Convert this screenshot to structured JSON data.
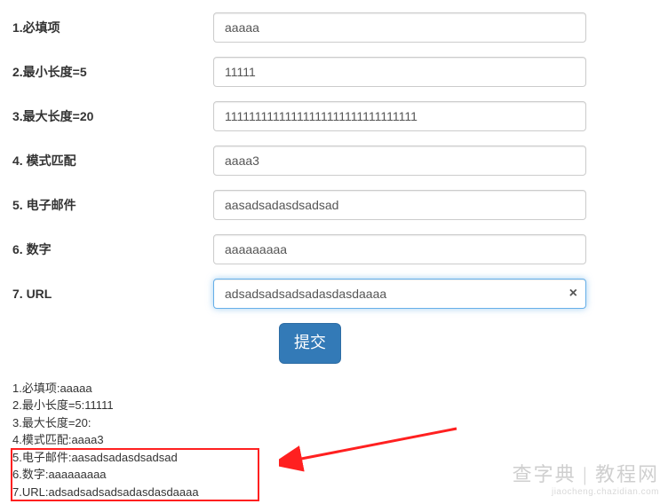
{
  "fields": [
    {
      "label": "1.必填项",
      "value": "aaaaa",
      "name": "required-input"
    },
    {
      "label": "2.最小长度=5",
      "value": "11111",
      "name": "minlength-input"
    },
    {
      "label": "3.最大长度=20",
      "value": "11111111111111111111111111111111",
      "name": "maxlength-input"
    },
    {
      "label": "4. 模式匹配",
      "value": "aaaa3",
      "name": "pattern-input"
    },
    {
      "label": "5. 电子邮件",
      "value": "aasadsadasdsadsad",
      "name": "email-input"
    },
    {
      "label": "6. 数字",
      "value": "aaaaaaaaa",
      "name": "number-input"
    },
    {
      "label": "7. URL",
      "value": "adsadsadsadsadasdasdaaaa",
      "name": "url-input",
      "focused": true,
      "hasClear": true
    }
  ],
  "submit_label": "提交",
  "output": [
    "1.必填项:aaaaa",
    "2.最小长度=5:11111",
    "3.最大长度=20:",
    "4.模式匹配:aaaa3",
    "5.电子邮件:aasadsadasdsadsad",
    "6.数字:aaaaaaaaa",
    "7.URL:adsadsadsadsadasdasdaaaa"
  ],
  "watermark": {
    "cn": "查字典 | 教程网",
    "url": "jiaocheng.chazidian.com"
  },
  "clear_icon": "×"
}
